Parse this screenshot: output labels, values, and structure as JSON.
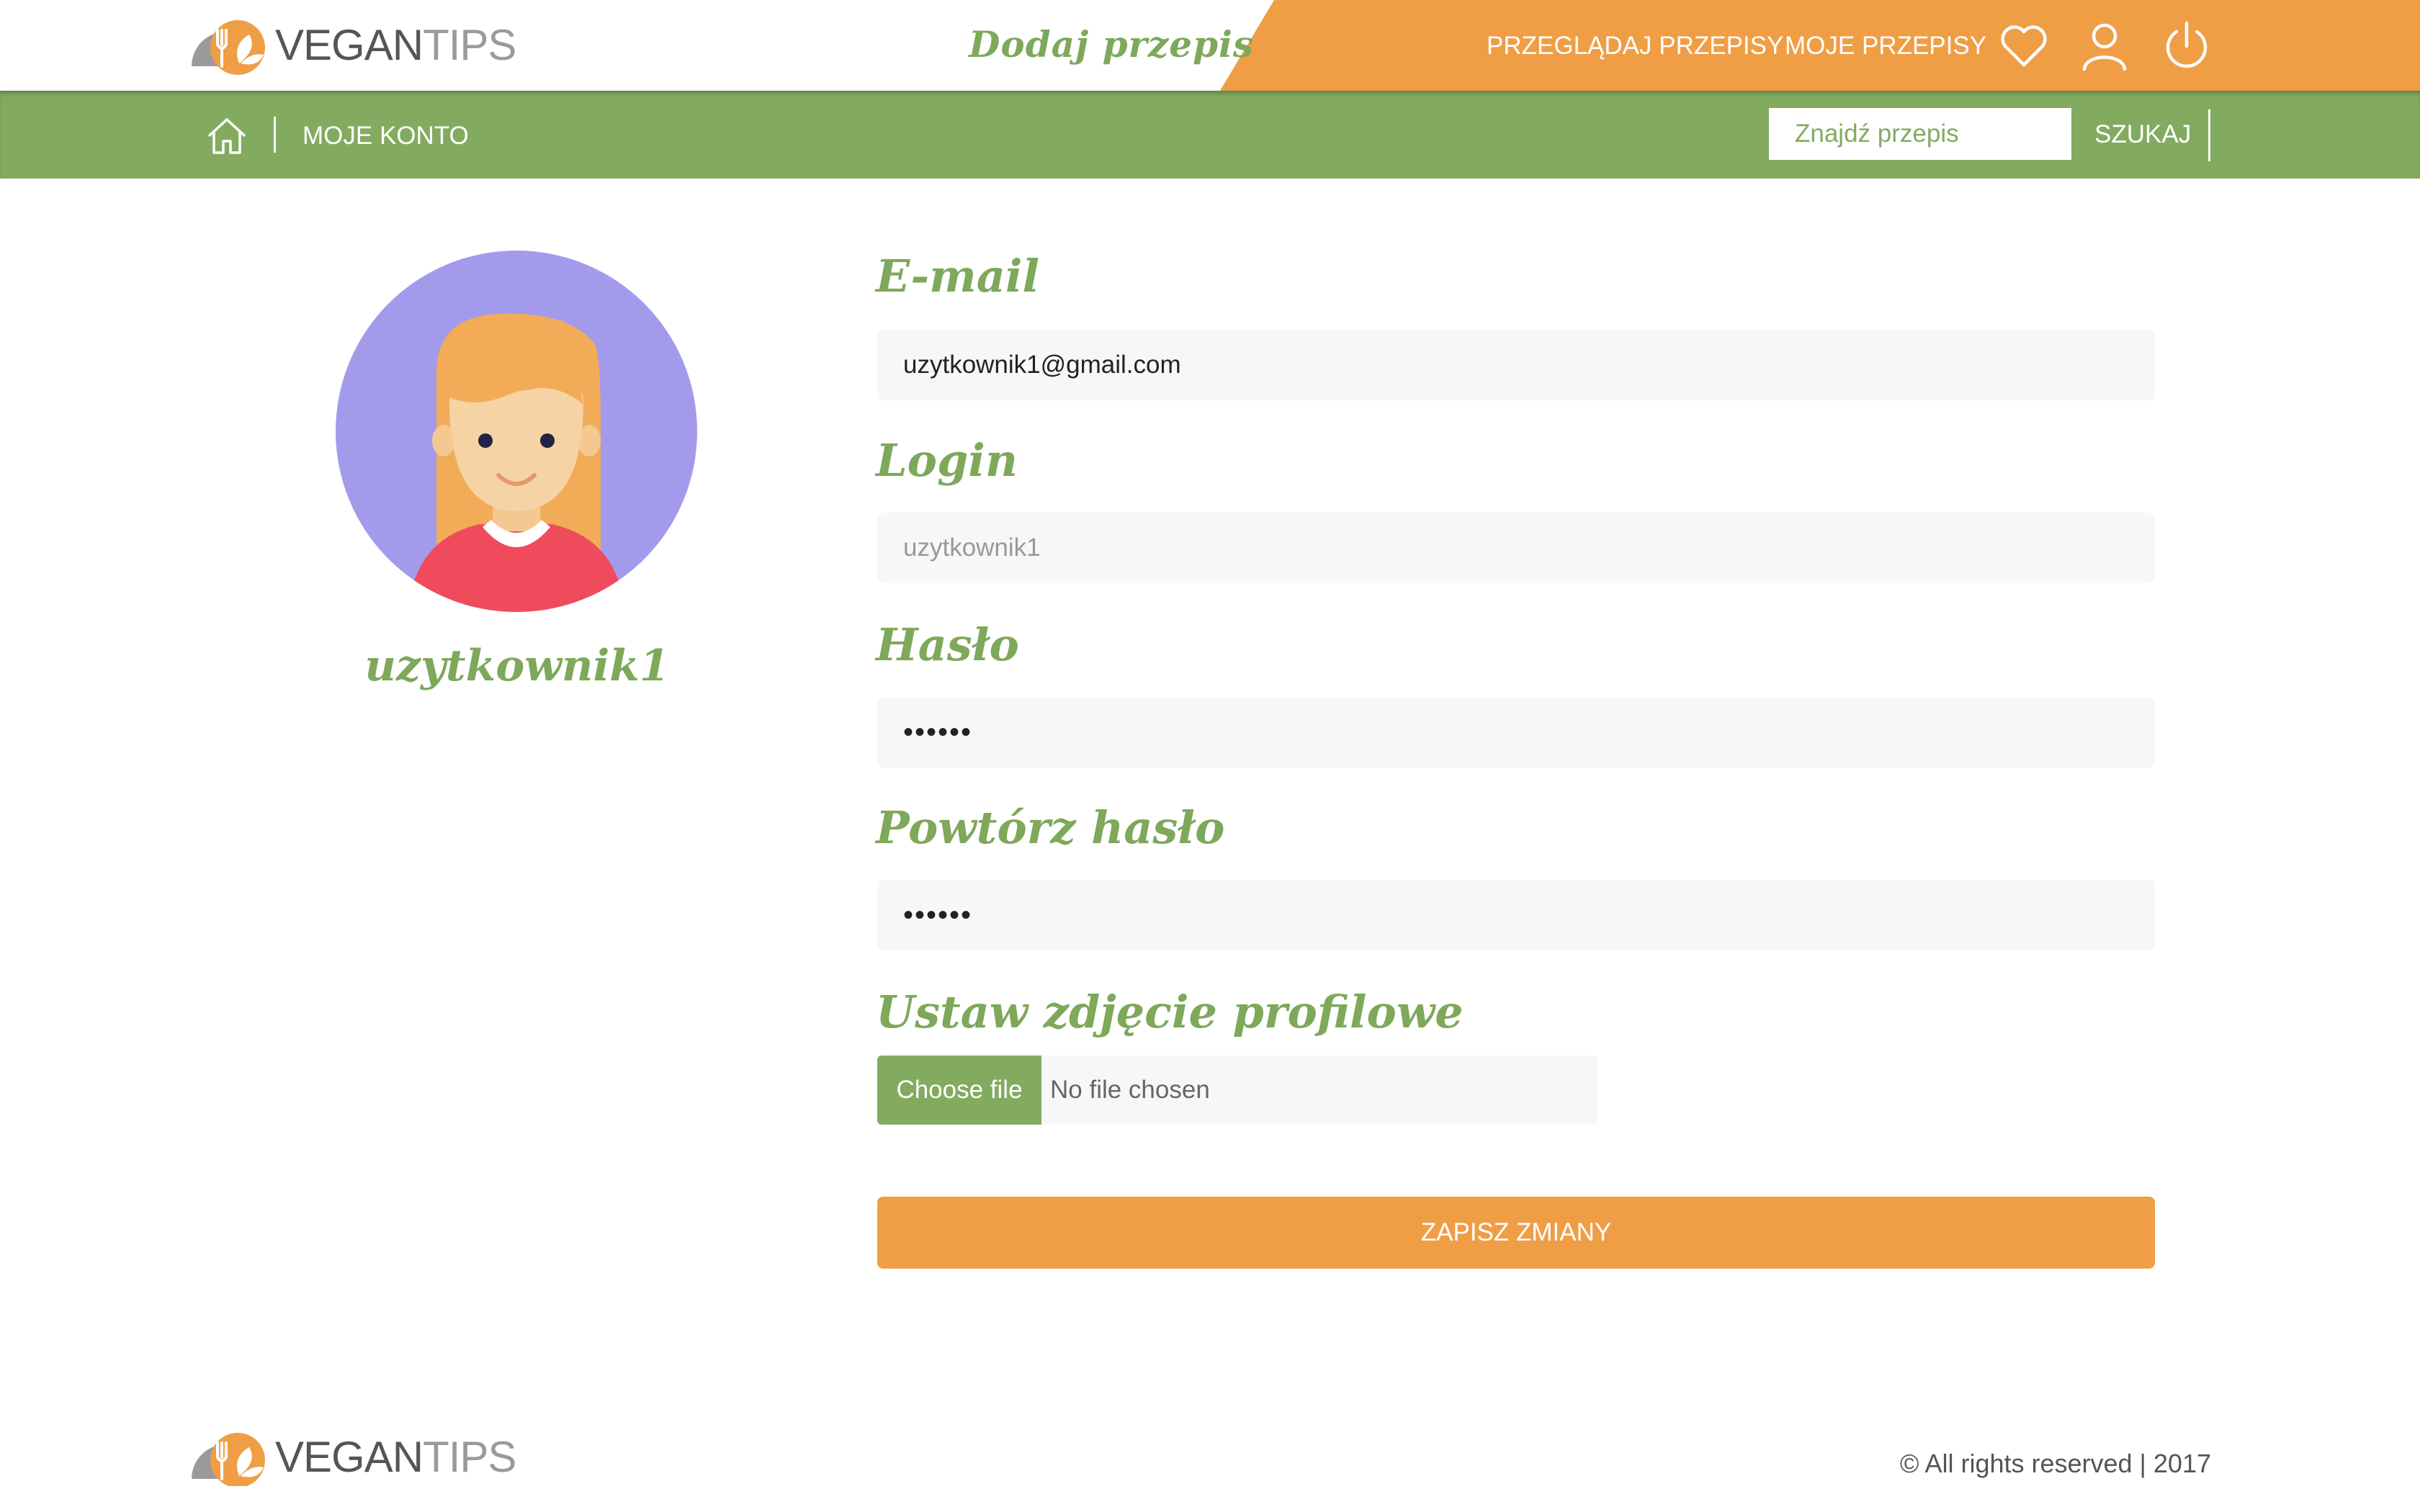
{
  "brand": {
    "name_primary": "VEGAN",
    "name_secondary": "TIPS"
  },
  "header": {
    "add_recipe": "Dodaj przepis",
    "nav": {
      "browse": "PRZEGLĄDAJ PRZEPISY",
      "my_recipes": "MOJE PRZEPISY"
    },
    "icons": {
      "favorites": "heart-icon",
      "account": "user-icon",
      "logout": "power-icon"
    }
  },
  "subbar": {
    "home_icon": "home-icon",
    "breadcrumb": "MOJE KONTO",
    "search": {
      "placeholder": "Znajdź przepis",
      "button": "SZUKAJ"
    }
  },
  "profile": {
    "username": "uzytkownik1"
  },
  "form": {
    "email": {
      "label": "E-mail",
      "value": "uzytkownik1@gmail.com"
    },
    "login": {
      "label": "Login",
      "value": "uzytkownik1"
    },
    "password": {
      "label": "Hasło",
      "value": "••••••"
    },
    "password_repeat": {
      "label": "Powtórz hasło",
      "value": "••••••"
    },
    "photo": {
      "label": "Ustaw zdjęcie profilowe",
      "button": "Choose file",
      "status": "No file chosen"
    },
    "save": "ZAPISZ ZMIANY"
  },
  "footer": {
    "copyright": "© All rights reserved | 2017"
  },
  "colors": {
    "orange": "#ef9e46",
    "green": "#83ab5f",
    "label_green": "#7ea85a",
    "avatar_bg": "#a49aec"
  }
}
